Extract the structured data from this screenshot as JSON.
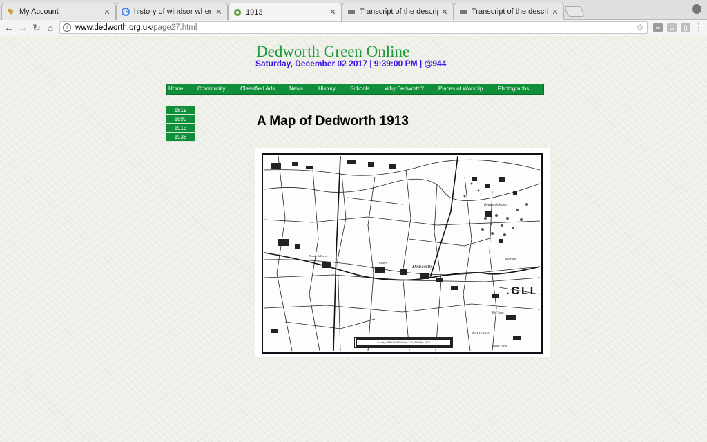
{
  "browser": {
    "tabs": [
      {
        "title": "My Account",
        "icon": "tag-icon",
        "active": false
      },
      {
        "title": "history of windsor when were",
        "icon": "google-icon",
        "active": false
      },
      {
        "title": "1913",
        "icon": "site-icon",
        "active": true
      },
      {
        "title": "Transcript of the description o",
        "icon": "page-icon",
        "active": false
      },
      {
        "title": "Transcript of the description o",
        "icon": "page-icon",
        "active": false
      }
    ],
    "url_host": "www.dedworth.org.uk",
    "url_path": "/page27.html"
  },
  "site": {
    "title": "Dedworth Green Online",
    "datetime": "Saturday, December 02 2017 | 9:39:00 PM | @944"
  },
  "nav": [
    "Home",
    "Community",
    "Classified Ads",
    "News",
    "History",
    "Schools",
    "Why Dedworth?",
    "Places of Worship",
    "Photographs"
  ],
  "subnav": [
    "1819",
    "1890",
    "1913",
    "1938"
  ],
  "page_title": "A Map of Dedworth 1913",
  "map": {
    "labels": [
      "Dedworth",
      "Dedworth Manor",
      "Dedworth Farm",
      "Church",
      "Vale Farm",
      "Bell Farm",
      "Manor Farm",
      "Park Corner"
    ],
    "caption": "County: BERKSHIRE  Scale: 1:10,560  Date: 1913"
  },
  "colors": {
    "accent_green": "#0f8f3a",
    "title_green": "#1d9b3c",
    "date_blue": "#3f14e8"
  }
}
